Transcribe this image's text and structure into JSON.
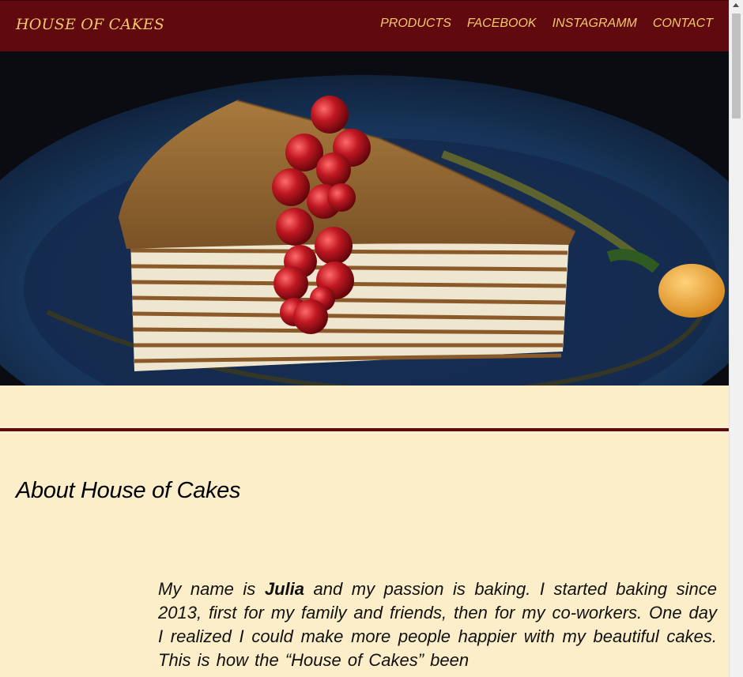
{
  "navbar": {
    "brand": "HOUSE OF CAKES",
    "links": [
      "PRODUCTS",
      "FACEBOOK",
      "INSTAGRAMM",
      "CONTACT"
    ]
  },
  "hero": {
    "image": "layered honey cake slice with red currants on blue plate"
  },
  "about": {
    "title": "About House of Cakes",
    "text_before": "My name is ",
    "name": "Julia",
    "text_after": " and my passion is baking. I started baking since 2013, first for my family and friends, then for my co-workers. One day I realized I could make more people happier with my beautiful cakes. This is how the “House of Cakes” been"
  },
  "colors": {
    "nav_bg": "#600a0f",
    "nav_text": "#f4c86a",
    "page_bg": "#fbeec8"
  }
}
